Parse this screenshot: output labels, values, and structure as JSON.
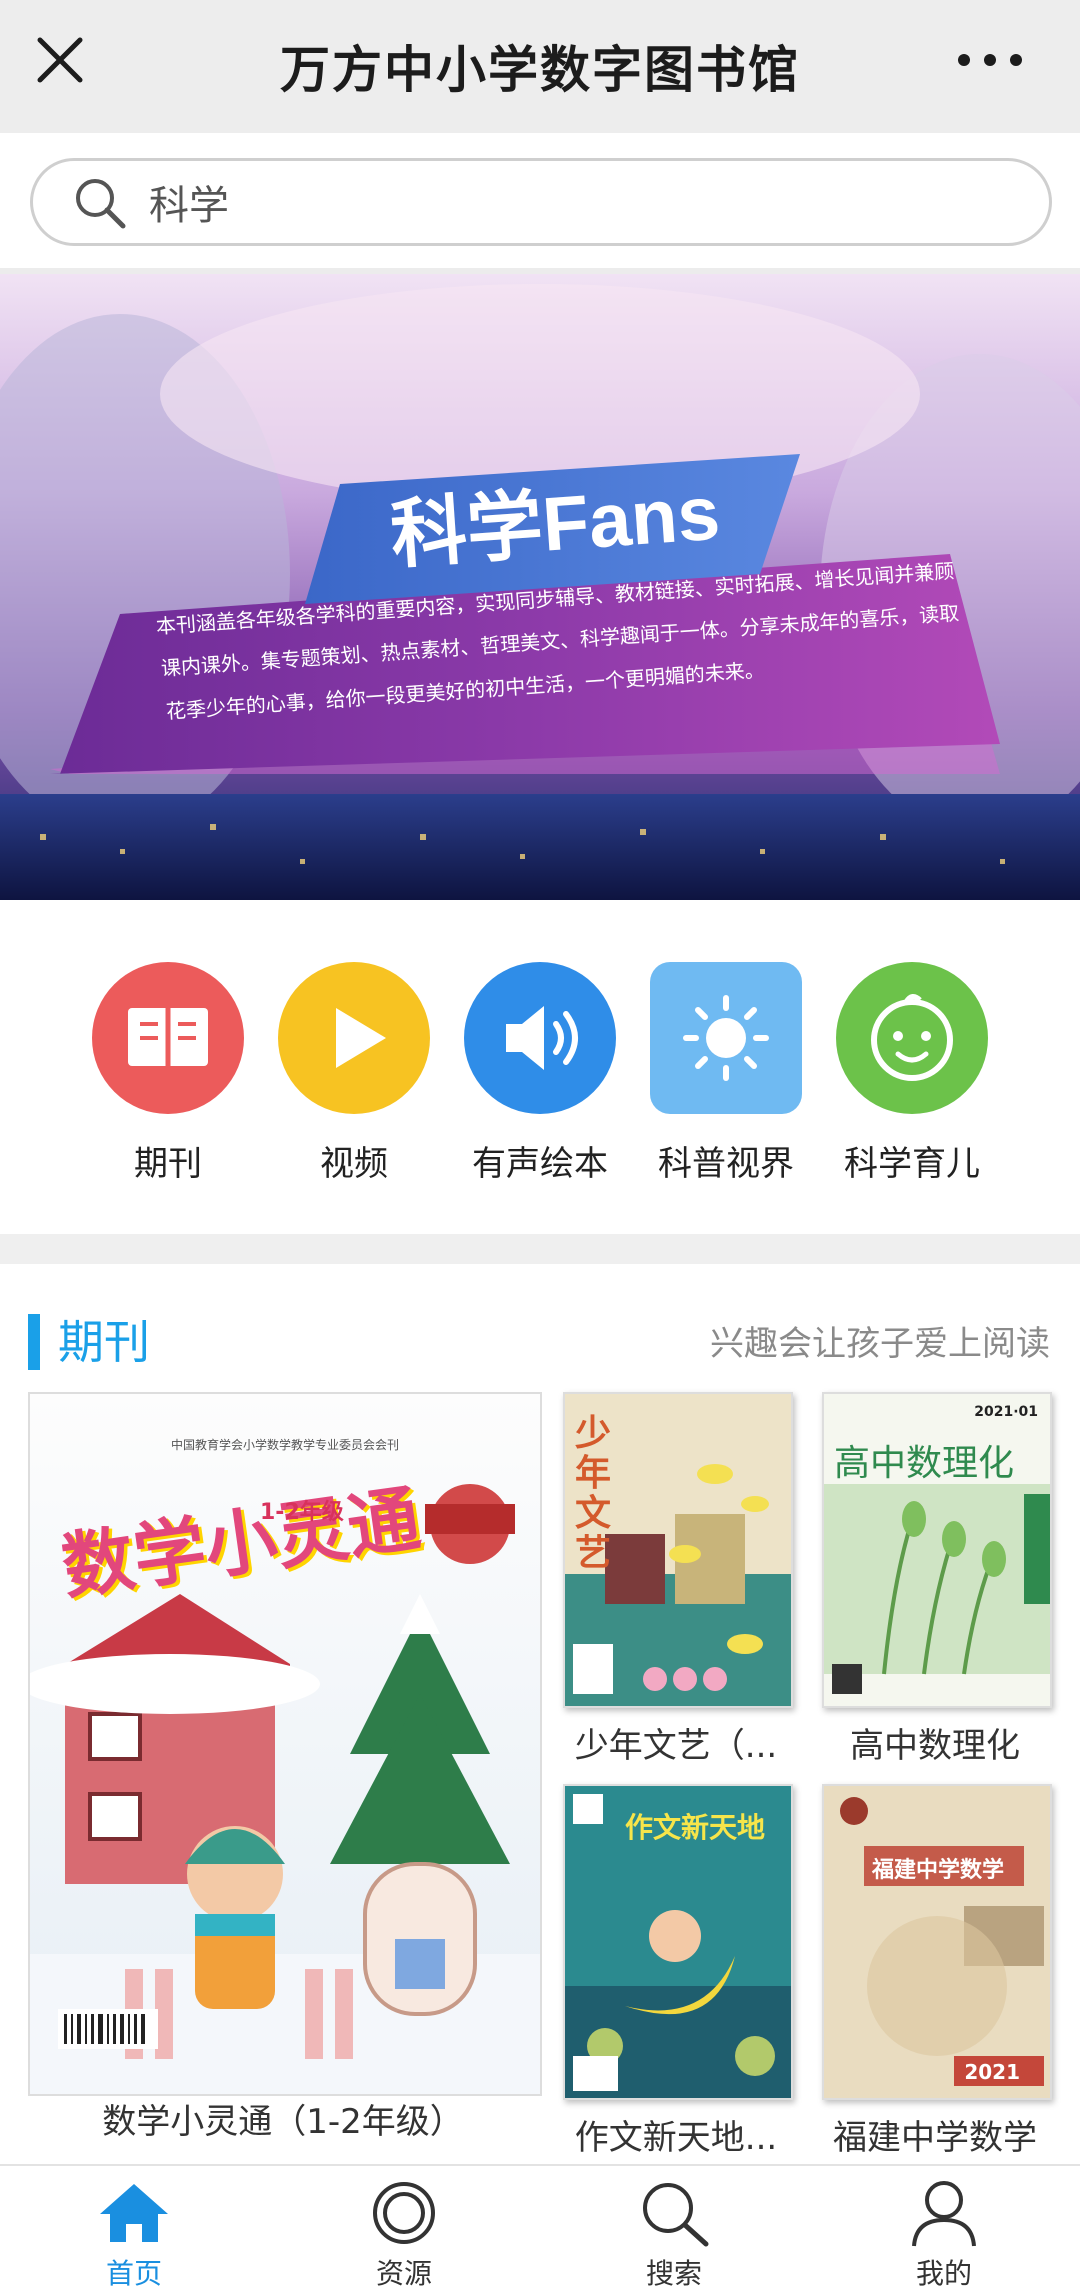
{
  "header": {
    "title": "万方中小学数字图书馆",
    "close_icon": "close-icon",
    "more_icon": "more-icon"
  },
  "search": {
    "value": "科学",
    "icon": "search-icon"
  },
  "banner": {
    "title": "科学Fans",
    "line1": "本刊涵盖各年级各学科的重要内容，实现同步辅导、教材链接、实时拓展、增长见闻并兼顾",
    "line2": "课内课外。集专题策划、热点素材、哲理美文、科学趣闻于一体。分享未成年的喜乐，读取",
    "line3": "花季少年的心事，给你一段更美好的初中生活，一个更明媚的未来。"
  },
  "categories": [
    {
      "label": "期刊",
      "icon": "book-icon",
      "color": "#ec5b5b"
    },
    {
      "label": "视频",
      "icon": "play-icon",
      "color": "#f7c322"
    },
    {
      "label": "有声绘本",
      "icon": "speaker-icon",
      "color": "#2f8de8"
    },
    {
      "label": "科普视界",
      "icon": "sun-icon",
      "color": "#6fbaf2"
    },
    {
      "label": "科学育儿",
      "icon": "baby-face-icon",
      "color": "#6cc24a"
    }
  ],
  "section": {
    "title": "期刊",
    "subtitle": "兴趣会让孩子爱上阅读",
    "featured": {
      "caption": "数学小灵通（1-2年级）",
      "cover_title": "数学小灵通",
      "cover_grade": "1-2年级",
      "cover_header": "中国教育学会小学数学教学专业委员会会刊"
    },
    "items": [
      {
        "caption": "少年文艺（...",
        "cover_title": "少年文艺"
      },
      {
        "caption": "高中数理化",
        "cover_title": "高中数理化",
        "cover_issue": "2021·01"
      },
      {
        "caption": "作文新天地...",
        "cover_title": "作文新天地"
      },
      {
        "caption": "福建中学数学",
        "cover_title": "福建中学数学",
        "cover_issue": "2021"
      }
    ]
  },
  "bottom_nav": [
    {
      "label": "首页",
      "icon": "home-icon",
      "active": true
    },
    {
      "label": "资源",
      "icon": "resource-icon",
      "active": false
    },
    {
      "label": "搜索",
      "icon": "search-icon",
      "active": false
    },
    {
      "label": "我的",
      "icon": "user-icon",
      "active": false
    }
  ],
  "colors": {
    "accent": "#1aa0e8",
    "nav_active": "#1a8fe0"
  }
}
